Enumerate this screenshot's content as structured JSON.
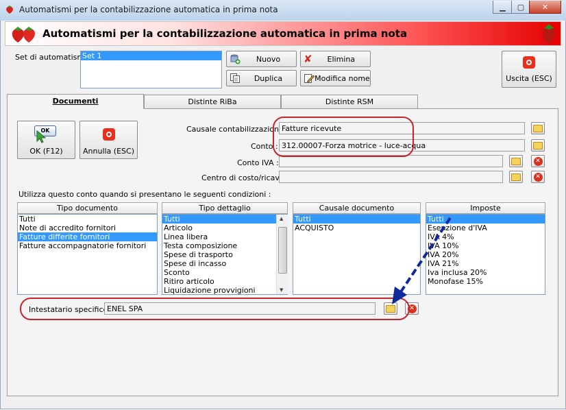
{
  "window": {
    "title": "Automatismi per la contabilizzazione automatica in prima nota"
  },
  "banner": {
    "title": "Automatismi per la contabilizzazione automatica in prima nota"
  },
  "set": {
    "label": "Set di automatismi :",
    "items": [
      "Set 1"
    ],
    "buttons": {
      "nuovo": "Nuovo",
      "elimina": "Elimina",
      "duplica": "Duplica",
      "modifica": "Modifica nome"
    }
  },
  "exit_button": "Uscita (ESC)",
  "tabs": [
    "Documenti",
    "Distinte RiBa",
    "Distinte RSM"
  ],
  "ok_button": "OK (F12)",
  "ok_icon_text": "OK",
  "annulla_button": "Annulla (ESC)",
  "fields": {
    "causale": {
      "label": "Causale contabilizzazione :",
      "value": "Fatture ricevute"
    },
    "conto": {
      "label": "Conto :",
      "value": "312.00007-Forza motrice - luce-acqua"
    },
    "conto_iva": {
      "label": "Conto IVA :",
      "value": ""
    },
    "centro": {
      "label": "Centro di costo/ricavo :",
      "value": ""
    }
  },
  "conditions_label": "Utilizza questo conto quando si presentano le seguenti condizioni :",
  "lists": {
    "tipo_documento": {
      "header": "Tipo documento",
      "items": [
        "Tutti",
        "Note di accredito fornitori",
        "Fatture differite fornitori",
        "Fatture accompagnatorie fornitori"
      ],
      "selected": [
        2
      ]
    },
    "tipo_dettaglio": {
      "header": "Tipo dettaglio",
      "items": [
        "Tutti",
        "Articolo",
        "Linea libera",
        "Testa composizione",
        "Spese di trasporto",
        "Spese di incasso",
        "Sconto",
        "Ritiro articolo",
        "Liquidazione provvigioni"
      ],
      "selected": [
        0
      ]
    },
    "causale_documento": {
      "header": "Causale documento",
      "items": [
        "Tutti",
        "ACQUISTO"
      ],
      "selected": [
        0
      ]
    },
    "imposte": {
      "header": "Imposte",
      "items": [
        "Tutti",
        "Esenzione d'IVA",
        "IVA 4%",
        "IVA 10%",
        "IVA 20%",
        "IVA 21%",
        "Iva inclusa 20%",
        "Monofase 15%"
      ],
      "selected": [
        0
      ]
    }
  },
  "intestatario": {
    "label": "Intestatario specifico :",
    "value": "ENEL SPA"
  },
  "colors": {
    "banner_red": "#e60000",
    "selection": "#3399ff",
    "annotation_red": "#c8232c",
    "annotation_arrow": "#102a9c"
  }
}
